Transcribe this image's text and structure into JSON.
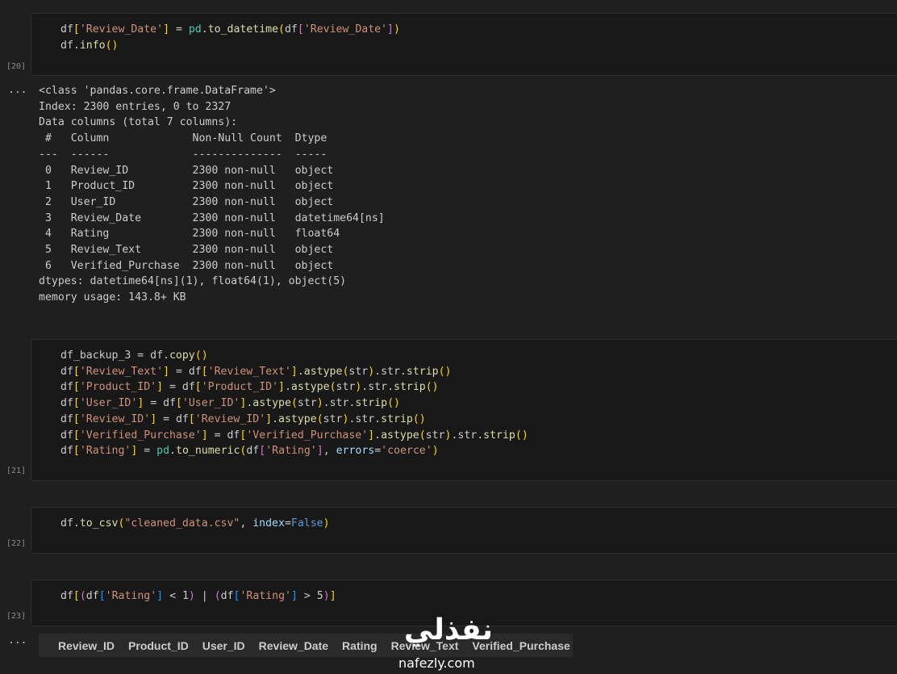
{
  "cells": [
    {
      "exec_count": "[20]",
      "code_lines": [
        "df['Review_Date'] = pd.to_datetime(df['Review_Date'])",
        "df.info()"
      ]
    },
    {
      "exec_count": "[21]",
      "code_lines": [
        "df_backup_3 = df.copy()",
        "df['Review_Text'] = df['Review_Text'].astype(str).str.strip()",
        "df['Product_ID'] = df['Product_ID'].astype(str).str.strip()",
        "df['User_ID'] = df['User_ID'].astype(str).str.strip()",
        "df['Review_ID'] = df['Review_ID'].astype(str).str.strip()",
        "df['Verified_Purchase'] = df['Verified_Purchase'].astype(str).str.strip()",
        "df['Rating'] = pd.to_numeric(df['Rating'], errors='coerce')"
      ]
    },
    {
      "exec_count": "[22]",
      "code_lines": [
        "df.to_csv(\"cleaned_data.csv\", index=False)"
      ]
    },
    {
      "exec_count": "[23]",
      "code_lines": [
        "df[(df['Rating'] < 1) | (df['Rating'] > 5)]"
      ]
    }
  ],
  "output_menu_label": "...",
  "info_output": "<class 'pandas.core.frame.DataFrame'>\nIndex: 2300 entries, 0 to 2327\nData columns (total 7 columns):\n #   Column             Non-Null Count  Dtype         \n---  ------             --------------  -----         \n 0   Review_ID          2300 non-null   object        \n 1   Product_ID         2300 non-null   object        \n 2   User_ID            2300 non-null   object        \n 3   Review_Date        2300 non-null   datetime64[ns]\n 4   Rating             2300 non-null   float64       \n 5   Review_Text        2300 non-null   object        \n 6   Verified_Purchase  2300 non-null   object        \ndtypes: datetime64[ns](1), float64(1), object(5)\nmemory usage: 143.8+ KB",
  "dataframe_headers": [
    "Review_ID",
    "Product_ID",
    "User_ID",
    "Review_Date",
    "Rating",
    "Review_Text",
    "Verified_Purchase"
  ],
  "watermark": {
    "logo_text": "نفذلي",
    "url": "nafezly.com"
  },
  "colors": {
    "background": "#1f1f1f",
    "cell_background": "#181818",
    "string": "#ce9178",
    "function": "#dcdcaa",
    "builtin": "#4ec9b0",
    "keyword": "#569cd6",
    "parameter": "#9cdcfe"
  }
}
